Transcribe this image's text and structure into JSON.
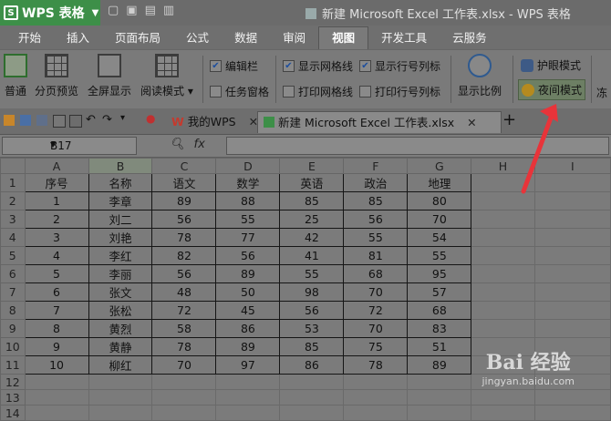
{
  "app": {
    "name": "WPS 表格",
    "logo_letter": "S",
    "doc_title": "新建 Microsoft Excel 工作表.xlsx - WPS 表格"
  },
  "tabs": [
    {
      "label": "开始"
    },
    {
      "label": "插入"
    },
    {
      "label": "页面布局"
    },
    {
      "label": "公式"
    },
    {
      "label": "数据"
    },
    {
      "label": "审阅"
    },
    {
      "label": "视图",
      "active": true
    },
    {
      "label": "开发工具"
    },
    {
      "label": "云服务"
    }
  ],
  "ribbon": {
    "normal_view": "普通",
    "page_break_preview": "分页预览",
    "full_screen": "全屏显示",
    "reading_mode": "阅读模式",
    "edit_bar": "编辑栏",
    "task_pane": "任务窗格",
    "show_gridlines": "显示网格线",
    "print_gridlines": "打印网格线",
    "show_headers": "显示行号列标",
    "print_headers": "打印行号列标",
    "show_zoom": "显示比例",
    "eye_protect": "护眼模式",
    "night_mode": "夜间模式",
    "freeze_partial": "冻"
  },
  "doc_tabs": {
    "my_wps": "我的WPS",
    "file": "新建 Microsoft Excel 工作表.xlsx"
  },
  "formula_bar": {
    "cell_ref": "B17",
    "fx": "fx"
  },
  "columns": [
    "A",
    "B",
    "C",
    "D",
    "E",
    "F",
    "G",
    "H",
    "I"
  ],
  "rows": [
    "1",
    "2",
    "3",
    "4",
    "5",
    "6",
    "7",
    "8",
    "9",
    "10",
    "11",
    "12",
    "13",
    "14"
  ],
  "table": {
    "header": [
      "序号",
      "名称",
      "语文",
      "数学",
      "英语",
      "政治",
      "地理"
    ],
    "body": [
      [
        "1",
        "李章",
        "89",
        "88",
        "85",
        "85",
        "80"
      ],
      [
        "2",
        "刘二",
        "56",
        "55",
        "25",
        "56",
        "70"
      ],
      [
        "3",
        "刘艳",
        "78",
        "77",
        "42",
        "55",
        "54"
      ],
      [
        "4",
        "李红",
        "82",
        "56",
        "41",
        "81",
        "55"
      ],
      [
        "5",
        "李丽",
        "56",
        "89",
        "55",
        "68",
        "95"
      ],
      [
        "6",
        "张文",
        "48",
        "50",
        "98",
        "70",
        "57"
      ],
      [
        "7",
        "张松",
        "72",
        "45",
        "56",
        "72",
        "68"
      ],
      [
        "8",
        "黄烈",
        "58",
        "86",
        "53",
        "70",
        "83"
      ],
      [
        "9",
        "黄静",
        "78",
        "89",
        "85",
        "75",
        "51"
      ],
      [
        "10",
        "柳红",
        "70",
        "97",
        "86",
        "78",
        "89"
      ]
    ]
  },
  "watermark": {
    "brand": "Bai 经验",
    "url": "jingyan.baidu.com"
  },
  "colors": {
    "arrow": "#e8343a",
    "accent_green": "#3d8f48"
  }
}
